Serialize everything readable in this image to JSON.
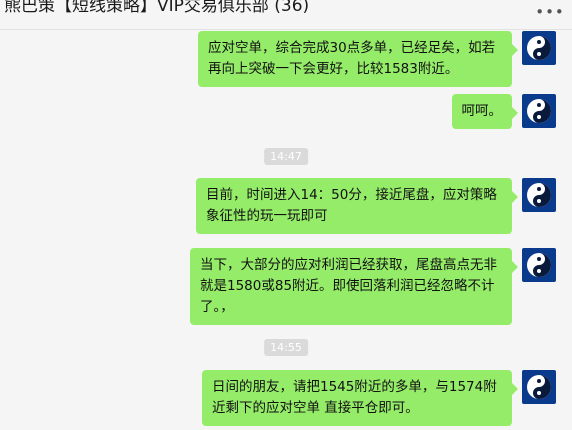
{
  "window": {
    "title": "熊巴策【短线策略】VIP交易俱乐部 (36)",
    "more_icon": "more-dots-icon"
  },
  "chat": {
    "messages": [
      {
        "text": "应对空单，综合完成30点多单，已经足矣，如若再向上突破一下会更好，比较1583附近。",
        "sender": "self"
      },
      {
        "text": "呵呵。",
        "sender": "self"
      },
      {
        "text": "目前，时间进入14：50分，接近尾盘，应对策略象征性的玩一玩即可",
        "sender": "self"
      },
      {
        "text": "当下，大部分的应对利润已经获取，尾盘高点无非就是1580或85附近。即使回落利润已经忽略不计了。，",
        "sender": "self"
      },
      {
        "text": "日间的朋友，请把1545附近的多单，与1574附近剩下的应对空单 直接平仓即可。",
        "sender": "self"
      }
    ],
    "timestamps": [
      "14:47",
      "14:55"
    ],
    "avatar_icon": "yin-yang-icon"
  },
  "colors": {
    "bubble": "#95ec69",
    "background": "#f5f5f5",
    "avatar_bg": "#0a3a8c"
  }
}
